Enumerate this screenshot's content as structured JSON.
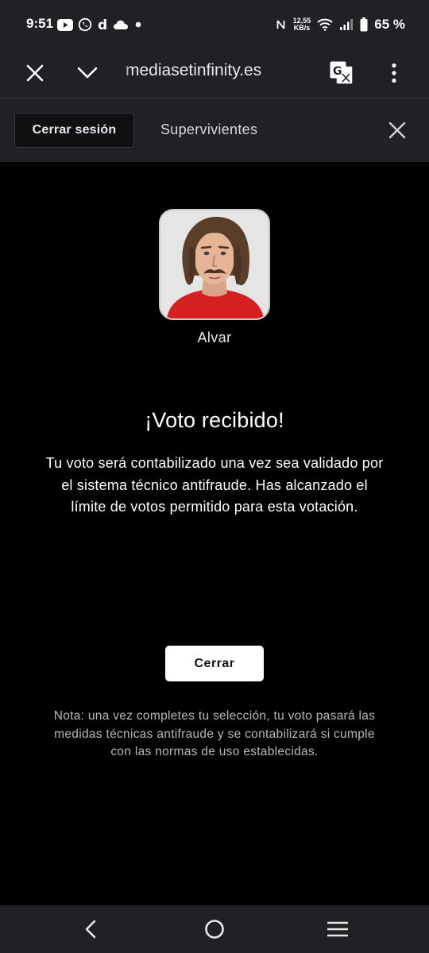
{
  "status_bar": {
    "time": "9:51",
    "netspeed_value": "12,55",
    "netspeed_unit": "KB/s",
    "battery": "65 %",
    "icons_left": [
      "youtube-icon",
      "whatsapp-icon",
      "d-app-icon",
      "cloud-icon",
      "dot-icon"
    ],
    "icons_right": [
      "nfc-icon",
      "wifi-icon",
      "signal-icon",
      "battery-icon"
    ]
  },
  "browser": {
    "url": "mediasetinfinity.es",
    "icons": [
      "close-icon",
      "chevron-down-icon",
      "translate-icon",
      "more-vert-icon"
    ]
  },
  "toolbar": {
    "logout_label": "Cerrar sesión",
    "section_title": "Supervivientes"
  },
  "content": {
    "candidate_name": "Alvar",
    "headline": "¡Voto recibido!",
    "message": "Tu voto será contabilizado una vez sea validado por el sistema técnico antifraude. Has alcanzado el límite de votos permitido para esta votación.",
    "close_button": "Cerrar",
    "note": "Nota: una vez completes tu selección, tu voto pasará las medidas técnicas antifraude y se contabilizará si cumple con las normas de uso establecidas."
  },
  "colors": {
    "chrome_bg": "#202124",
    "page_bg": "#000000",
    "button_bg": "#ffffff",
    "shirt_red": "#d42020"
  }
}
